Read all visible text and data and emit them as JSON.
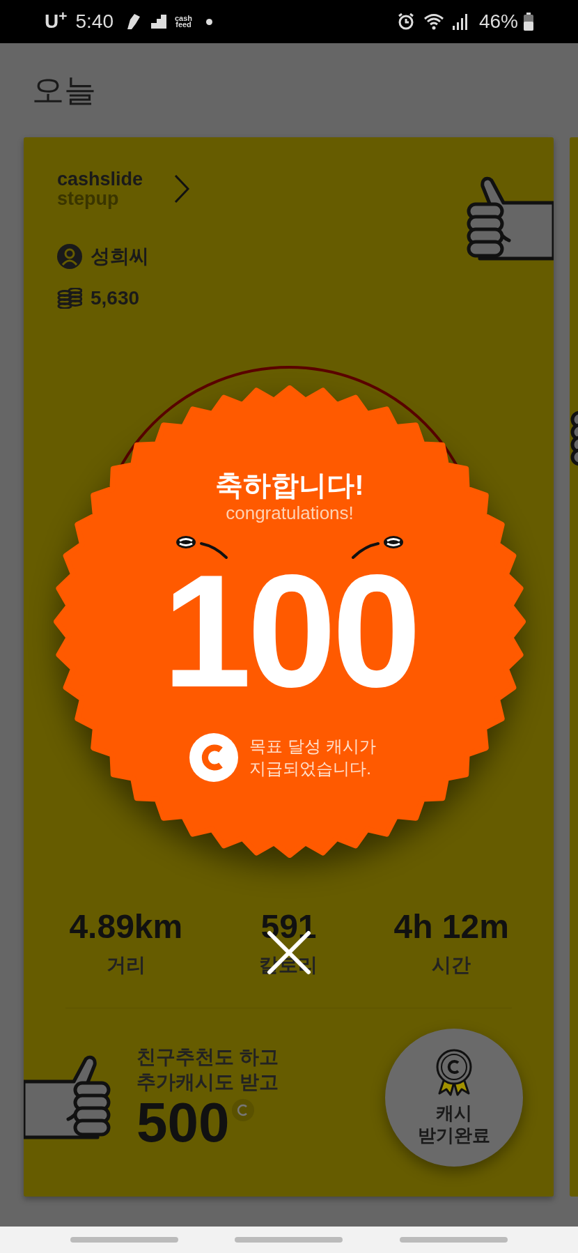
{
  "status_bar": {
    "carrier": "U$^{+}$",
    "time": "5:40",
    "app_badge": [
      "cash",
      "feed"
    ],
    "battery": "46%"
  },
  "page_title": "오늘",
  "card": {
    "brand": [
      "cashslide",
      "stepup"
    ],
    "user_name": "성희씨",
    "cash": "5,630",
    "stats": [
      {
        "value": "4.89km",
        "label": "거리"
      },
      {
        "value": "591",
        "label": "칼로리"
      },
      {
        "value": "4h 12m",
        "label": "시간"
      }
    ],
    "promo": {
      "lines": [
        "친구추천도 하고",
        "추가캐시도 받고"
      ],
      "amount": "500"
    },
    "claim_button": [
      "캐시",
      "받기완료"
    ]
  },
  "popup": {
    "title": "축하합니다!",
    "subtitle": "congratulations!",
    "amount": "100",
    "message": [
      "목표 달성 캐시가",
      "지급되었습니다."
    ]
  }
}
